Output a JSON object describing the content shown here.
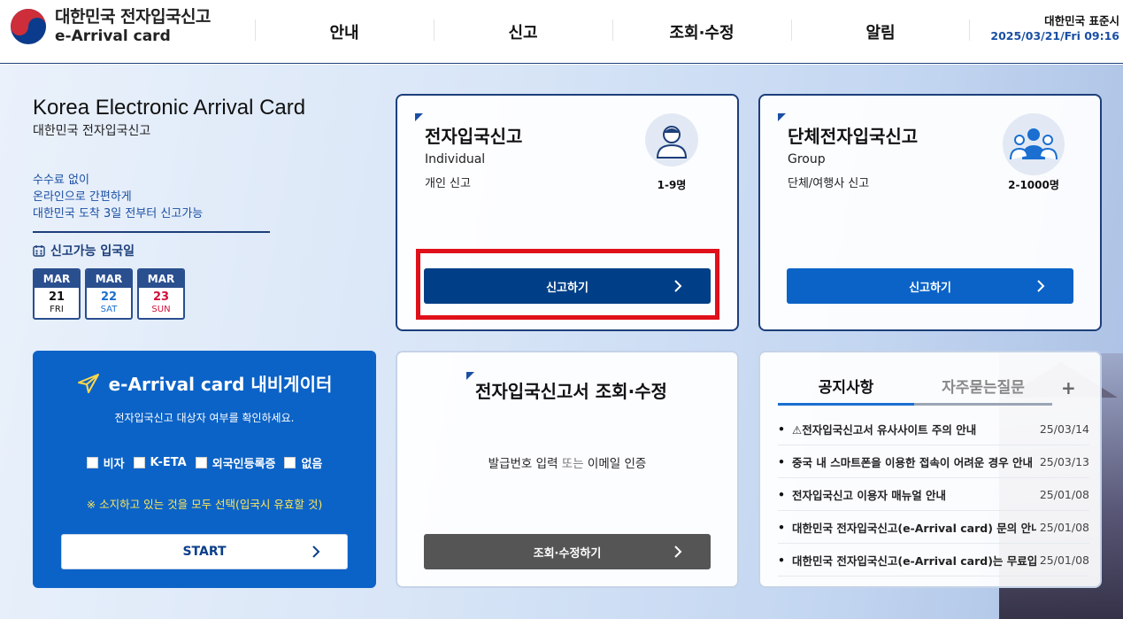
{
  "header": {
    "logo_ko": "대한민국 전자입국신고",
    "logo_en": "e-Arrival card",
    "nav": [
      "안내",
      "신고",
      "조회·수정",
      "알림"
    ],
    "clock_label": "대한민국 표준시",
    "clock_value": "2025/03/21/Fri 09:16"
  },
  "intro": {
    "title": "Korea Electronic Arrival Card",
    "subtitle": "대한민국 전자입국신고",
    "points": [
      "수수료 없이",
      "온라인으로 간편하게",
      "대한민국 도착 3일 전부터 신고가능"
    ],
    "available_label": "신고가능 입국일",
    "dates": [
      {
        "month": "MAR",
        "day": "21",
        "weekday": "FRI"
      },
      {
        "month": "MAR",
        "day": "22",
        "weekday": "SAT"
      },
      {
        "month": "MAR",
        "day": "23",
        "weekday": "SUN"
      }
    ]
  },
  "navigator": {
    "title": "e-Arrival card 내비게이터",
    "description": "전자입국신고 대상자 여부를 확인하세요.",
    "options": [
      "비자",
      "K-ETA",
      "외국인등록증",
      "없음"
    ],
    "note": "※ 소지하고 있는 것을 모두 선택(입국시 유효할 것)",
    "start_label": "START"
  },
  "individual": {
    "title": "전자입국신고",
    "en": "Individual",
    "ko": "개인 신고",
    "count": "1-9명",
    "button": "신고하기"
  },
  "group": {
    "title": "단체전자입국신고",
    "en": "Group",
    "ko": "단체/여행사 신고",
    "count": "2-1000명",
    "button": "신고하기"
  },
  "lookup": {
    "title": "전자입국신고서 조회·수정",
    "desc_a": "발급번호 입력 ",
    "desc_or": "또는",
    "desc_b": " 이메일 인증",
    "button": "조회·수정하기"
  },
  "notice": {
    "tab_active": "공지사항",
    "tab_inactive": "자주묻는질문",
    "plus": "+",
    "items": [
      {
        "title": "⚠전자입국신고서 유사사이트 주의 안내",
        "date": "25/03/14"
      },
      {
        "title": "중국 내 스마트폰을 이용한 접속이 어려운 경우 안내",
        "date": "25/03/13"
      },
      {
        "title": "전자입국신고 이용자 매뉴얼 안내",
        "date": "25/01/08"
      },
      {
        "title": "대한민국 전자입국신고(e-Arrival card) 문의 안내",
        "date": "25/01/08"
      },
      {
        "title": "대한민국 전자입국신고(e-Arrival card)는 무료입니다",
        "date": "25/01/08"
      }
    ]
  },
  "colors": {
    "primary_dark": "#003f87",
    "primary": "#0b63c7",
    "gray_button": "#555555",
    "highlight": "#e0101a"
  }
}
